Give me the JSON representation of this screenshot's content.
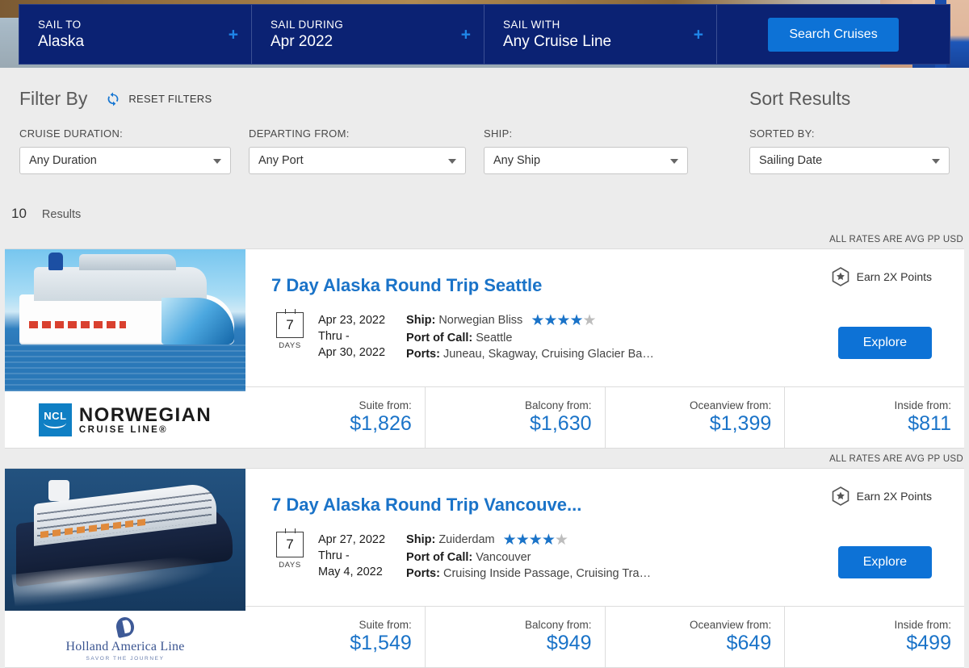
{
  "search_bar": {
    "fields": [
      {
        "label": "SAIL TO",
        "value": "Alaska",
        "plus": "+"
      },
      {
        "label": "SAIL DURING",
        "value": "Apr 2022",
        "plus": "+"
      },
      {
        "label": "SAIL WITH",
        "value": "Any Cruise Line",
        "plus": "+"
      }
    ],
    "search_button": "Search Cruises"
  },
  "filters": {
    "title": "Filter By",
    "reset_label": "RESET FILTERS",
    "reset_icon": "refresh-icon",
    "sort_title": "Sort Results",
    "groups": [
      {
        "label": "CRUISE DURATION:",
        "value": "Any Duration"
      },
      {
        "label": "DEPARTING FROM:",
        "value": "Any Port"
      },
      {
        "label": "SHIP:",
        "value": "Any Ship"
      },
      {
        "label": "SORTED BY:",
        "value": "Sailing Date"
      }
    ]
  },
  "results": {
    "count": "10",
    "word": "Results"
  },
  "cards": [
    {
      "rates_note": "ALL RATES ARE AVG PP USD",
      "title": "7 Day Alaska Round Trip Seattle",
      "days": "7",
      "days_label": "DAYS",
      "date_start": "Apr 23, 2022",
      "date_thru": "Thru -",
      "date_end": "Apr 30, 2022",
      "ship_key": "Ship:",
      "ship_value": "Norwegian Bliss",
      "stars_filled": 4,
      "stars_total": 5,
      "port_key": "Port of Call:",
      "port_value": "Seattle",
      "ports_key": "Ports:",
      "ports_value": "Juneau, Skagway, Cruising Glacier Ba…",
      "earn_label": "Earn 2X Points",
      "earn_icon": "hexagon-star-icon",
      "explore_label": "Explore",
      "line_logo": "norwegian-cruise-line-logo",
      "logo_name": "NORWEGIAN",
      "logo_sub": "CRUISE LINE®",
      "logo_badge": "NCL",
      "ship_image": "norwegian-bliss-ship-photo",
      "prices": [
        {
          "label": "Suite from:",
          "value": "$1,826"
        },
        {
          "label": "Balcony from:",
          "value": "$1,630"
        },
        {
          "label": "Oceanview from:",
          "value": "$1,399"
        },
        {
          "label": "Inside from:",
          "value": "$811"
        }
      ]
    },
    {
      "rates_note": "ALL RATES ARE AVG PP USD",
      "title": "7 Day Alaska Round Trip Vancouve...",
      "days": "7",
      "days_label": "DAYS",
      "date_start": "Apr 27, 2022",
      "date_thru": "Thru -",
      "date_end": "May 4, 2022",
      "ship_key": "Ship:",
      "ship_value": "Zuiderdam",
      "stars_filled": 4,
      "stars_total": 5,
      "port_key": "Port of Call:",
      "port_value": "Vancouver",
      "ports_key": "Ports:",
      "ports_value": "Cruising Inside Passage, Cruising Tra…",
      "earn_label": "Earn 2X Points",
      "earn_icon": "hexagon-star-icon",
      "explore_label": "Explore",
      "line_logo": "holland-america-line-logo",
      "logo_name": "Holland America Line",
      "logo_sub": "SAVOR THE JOURNEY",
      "ship_image": "zuiderdam-ship-photo",
      "prices": [
        {
          "label": "Suite from:",
          "value": "$1,549"
        },
        {
          "label": "Balcony from:",
          "value": "$949"
        },
        {
          "label": "Oceanview from:",
          "value": "$649"
        },
        {
          "label": "Inside from:",
          "value": "$499"
        }
      ]
    }
  ],
  "colors": {
    "navy": "#0b2273",
    "accent_blue": "#0d72d6",
    "link_blue": "#1a73c8",
    "page_bg": "#ececec",
    "star_on": "#1a73c8",
    "star_off": "#bdbdbd"
  }
}
